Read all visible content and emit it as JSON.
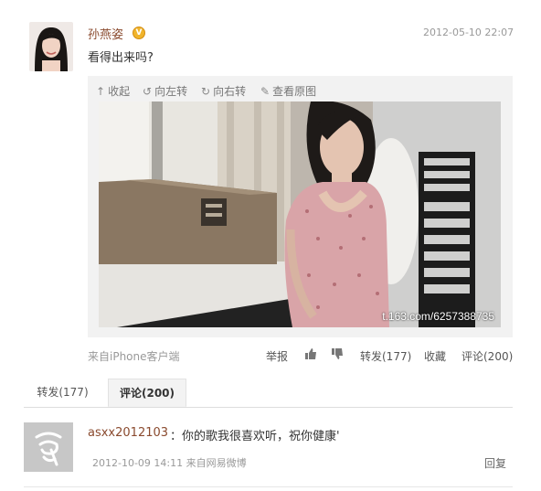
{
  "post": {
    "username": "孙燕姿",
    "badge": "V",
    "timestamp": "2012-05-10 22:07",
    "text": "看得出来吗?"
  },
  "media_toolbar": {
    "collapse": "收起",
    "rotate_left": "向左转",
    "rotate_right": "向右转",
    "view_original": "查看原图"
  },
  "photo": {
    "watermark": "t.163.com/6257388735"
  },
  "footer": {
    "source": "来自iPhone客户端",
    "report": "举报",
    "repost": "转发(177)",
    "favorite": "收藏",
    "comment": "评论(200)"
  },
  "tabs": [
    {
      "label": "转发(177)",
      "active": false
    },
    {
      "label": "评论(200)",
      "active": true
    }
  ],
  "comments": [
    {
      "user": "asxx2012103",
      "text": "：你的歌我很喜欢听，祝你健康'",
      "meta": "2012-10-09 14:11  来自网易微博",
      "reply": "回复"
    }
  ],
  "colors": {
    "username": "#8a4a2e",
    "muted": "#999999",
    "panel": "#f2f2f2"
  }
}
